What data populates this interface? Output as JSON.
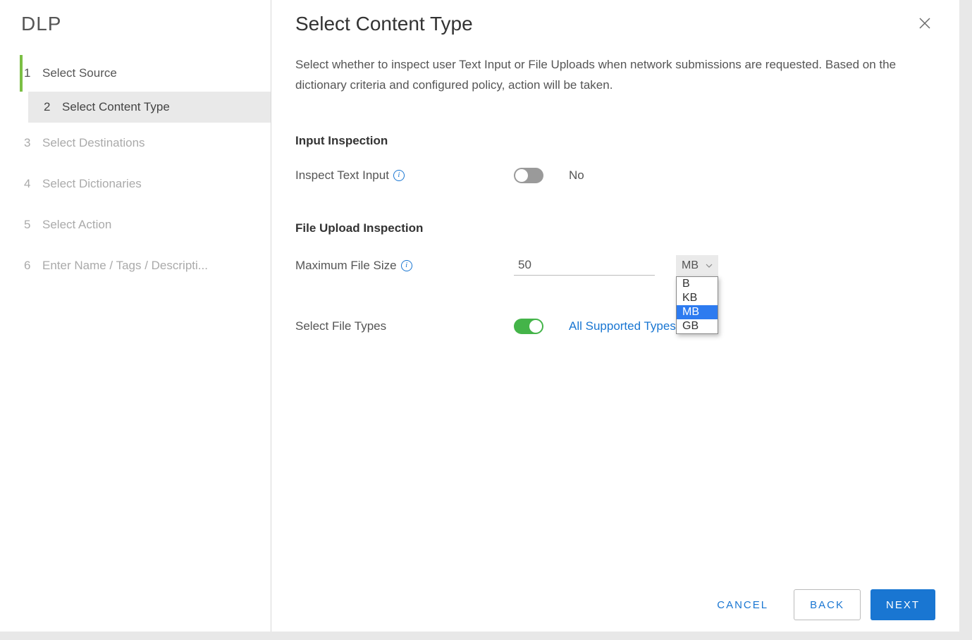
{
  "sidebar": {
    "logo": "DLP",
    "steps": [
      {
        "num": "1",
        "label": "Select Source",
        "state": "done"
      },
      {
        "num": "2",
        "label": "Select Content Type",
        "state": "active"
      },
      {
        "num": "3",
        "label": "Select Destinations",
        "state": "future"
      },
      {
        "num": "4",
        "label": "Select Dictionaries",
        "state": "future"
      },
      {
        "num": "5",
        "label": "Select Action",
        "state": "future"
      },
      {
        "num": "6",
        "label": "Enter Name / Tags / Descripti...",
        "state": "future"
      }
    ]
  },
  "header": {
    "title": "Select Content Type",
    "description": "Select whether to inspect user Text Input or File Uploads when network submissions are requested. Based on the dictionary criteria and configured policy, action will be taken."
  },
  "sections": {
    "input_inspection": {
      "title": "Input Inspection",
      "inspect_text_input_label": "Inspect Text Input",
      "inspect_text_input_value": false,
      "inspect_text_input_value_text": "No"
    },
    "file_upload_inspection": {
      "title": "File Upload Inspection",
      "max_file_size_label": "Maximum File Size",
      "max_file_size_value": "50",
      "unit_selected": "MB",
      "unit_options": [
        "B",
        "KB",
        "MB",
        "GB"
      ],
      "select_file_types_label": "Select File Types",
      "select_file_types_value": true,
      "select_file_types_value_text": "All Supported Types"
    }
  },
  "footer": {
    "cancel": "CANCEL",
    "back": "BACK",
    "next": "NEXT"
  }
}
